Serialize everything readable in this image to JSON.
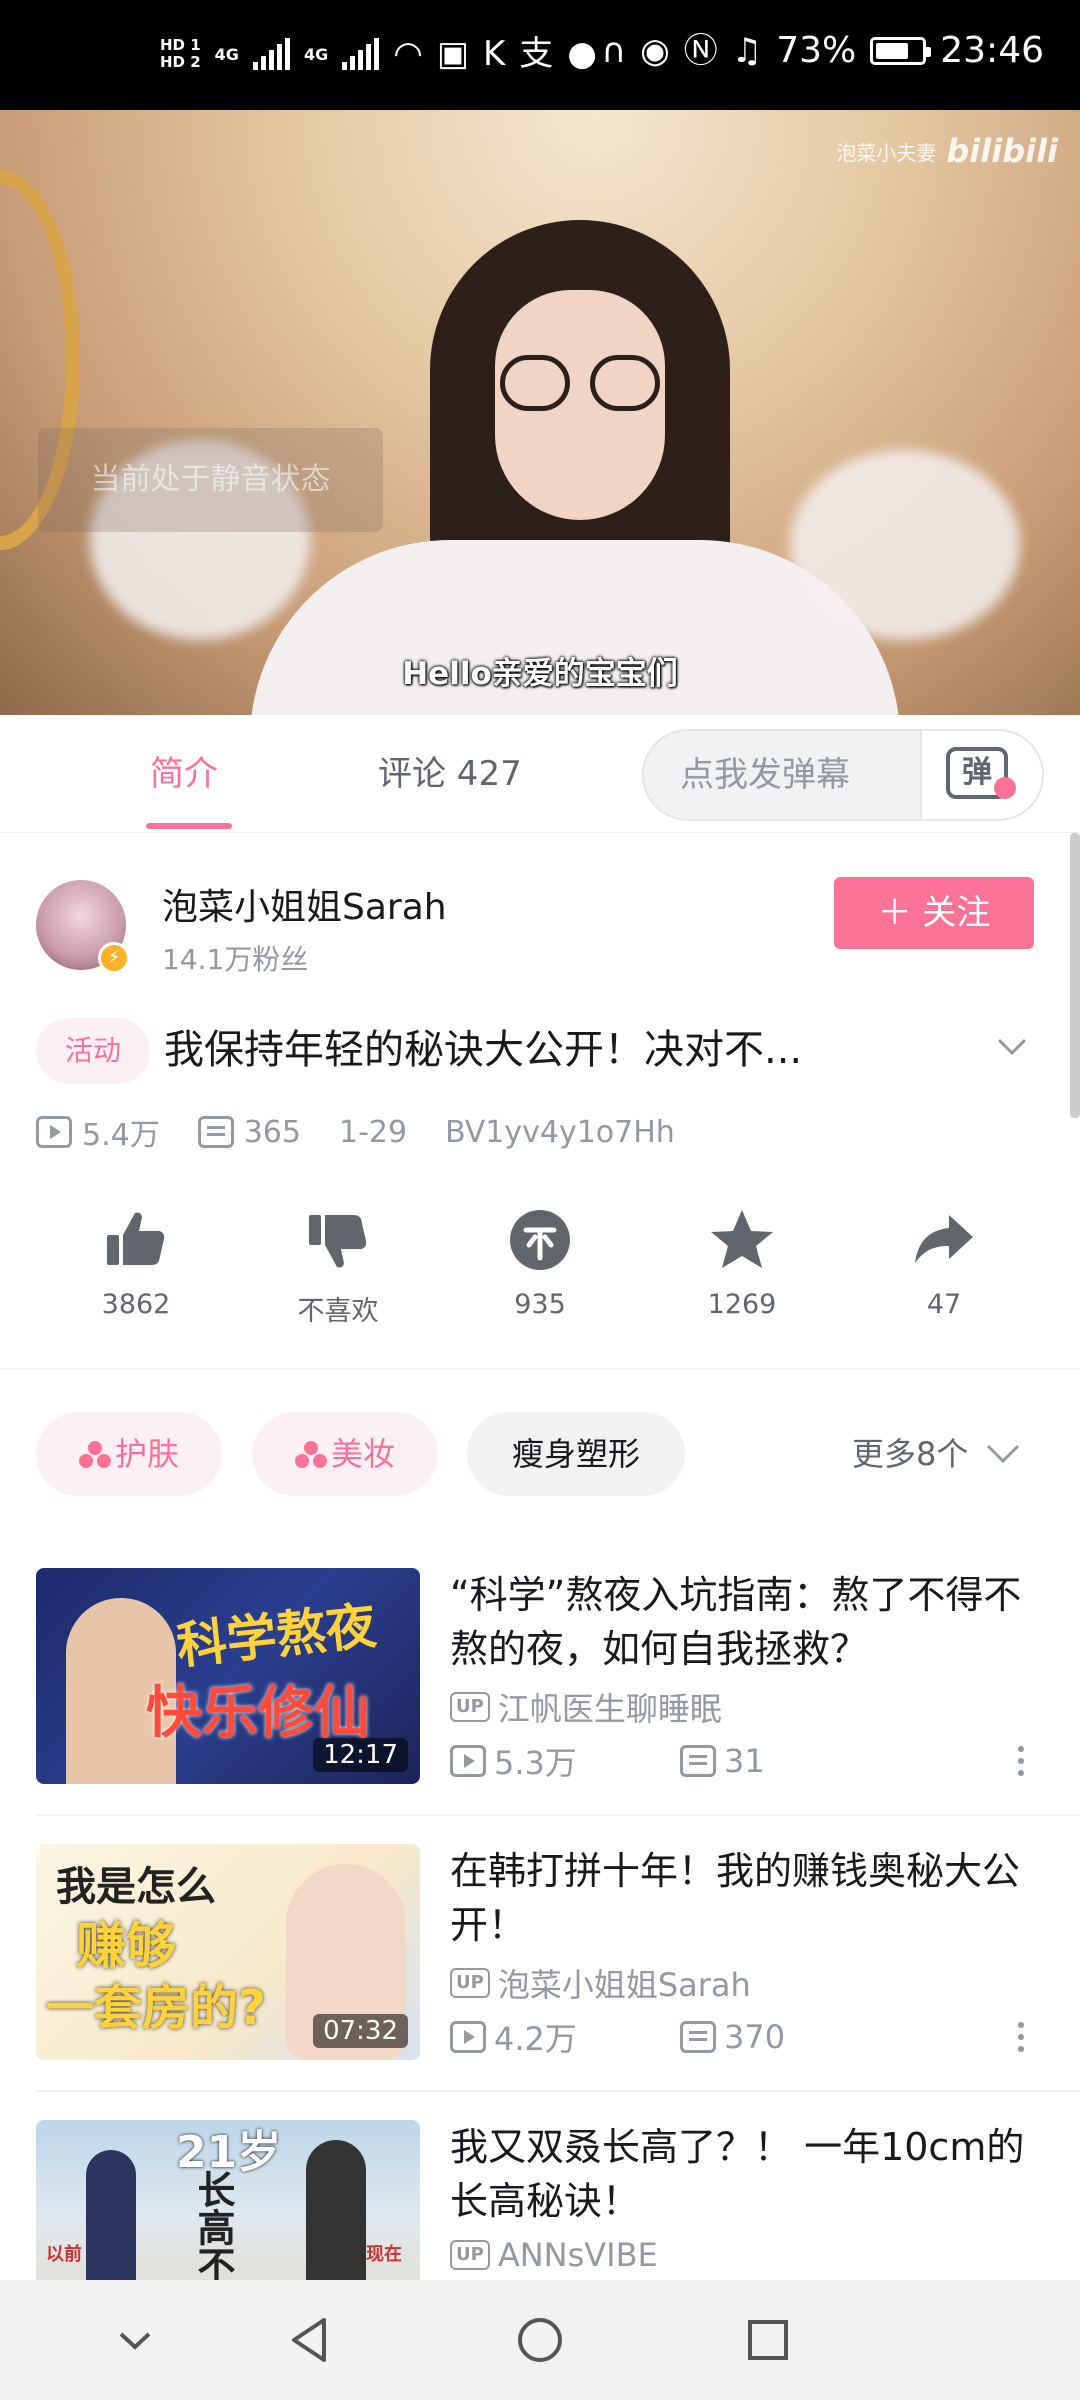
{
  "status_bar": {
    "network_hd1": "HD 1",
    "network_hd2": "HD 2",
    "net1": "4G",
    "net2": "4G",
    "battery": "73%",
    "time": "23:46",
    "battery_level": 0.73
  },
  "player": {
    "mute_toast": "当前处于静音状态",
    "watermark_channel": "泡菜小夫妻",
    "watermark_brand": "bilibili",
    "subtitle": "Hello亲爱的宝宝们"
  },
  "tabs": {
    "intro": "简介",
    "comments": "评论 427",
    "danmaku_placeholder": "点我发弹幕",
    "danmaku_icon": "弹"
  },
  "uploader": {
    "name": "泡菜小姐姐Sarah",
    "fans": "14.1万粉丝",
    "follow_label": "＋ 关注"
  },
  "video": {
    "tag": "活动",
    "title": "我保持年轻的秘诀大公开！决对不...",
    "views": "5.4万",
    "danmaku_count": "365",
    "date": "1-29",
    "bvid": "BV1yv4y1o7Hh"
  },
  "actions": {
    "like": "3862",
    "dislike": "不喜欢",
    "coin": "935",
    "favorite": "1269",
    "share": "47"
  },
  "tags": {
    "skin": "护肤",
    "makeup": "美妆",
    "slim": "瘦身塑形",
    "more": "更多8个"
  },
  "recommendations": [
    {
      "title": "“科学”熬夜入坑指南：熬了不得不熬的夜，如何自我拯救？",
      "up_badge": "UP",
      "up": "江帆医生聊睡眠",
      "views": "5.3万",
      "danmaku": "31",
      "duration": "12:17",
      "thumb_line1": "科学熬夜",
      "thumb_line2": "快乐修仙"
    },
    {
      "title": "在韩打拼十年！我的赚钱奥秘大公开！",
      "up_badge": "UP",
      "up": "泡菜小姐姐Sarah",
      "views": "4.2万",
      "danmaku": "370",
      "duration": "07:32",
      "thumb_line1": "我是怎么",
      "thumb_line2": "赚够",
      "thumb_line3": "一套房的?"
    },
    {
      "title": "我又双叒长高了？！ 一年10cm的长高秘诀！",
      "up_badge": "UP",
      "up": "ANNsVIBE",
      "thumb_line1": "21岁",
      "thumb_line2": "长高不",
      "thumb_tag_before": "以前",
      "thumb_tag_now": "现在"
    }
  ],
  "colors": {
    "brand_pink": "#fb7299",
    "text_gray": "#9499a0",
    "icon_gray": "#61666d"
  }
}
